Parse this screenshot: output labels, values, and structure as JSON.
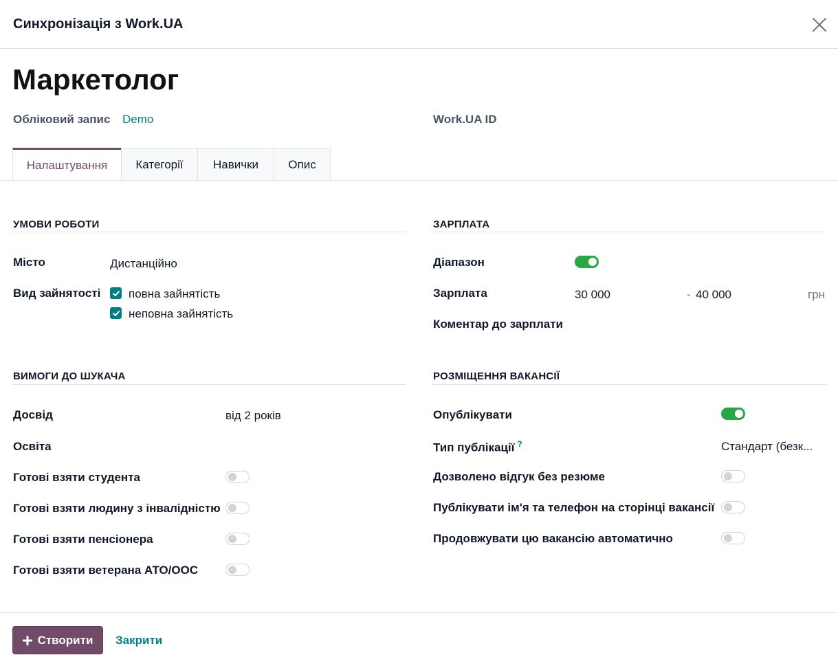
{
  "dialog": {
    "title": "Синхронізація з Work.UA"
  },
  "record": {
    "name": "Маркетолог",
    "account_label": "Обліковий запис",
    "account_value": "Demo",
    "workua_id_label": "Work.UA ID"
  },
  "tabs": [
    {
      "label": "Налаштування",
      "active": true
    },
    {
      "label": "Категорії",
      "active": false
    },
    {
      "label": "Навички",
      "active": false
    },
    {
      "label": "Опис",
      "active": false
    }
  ],
  "conditions": {
    "title": "УМОВИ РОБОТИ",
    "city_label": "Місто",
    "city_value": "Дистанційно",
    "employment_label": "Вид зайнятості",
    "employment_options": [
      {
        "label": "повна зайнятість",
        "checked": true
      },
      {
        "label": "неповна зайнятість",
        "checked": true
      }
    ]
  },
  "salary": {
    "title": "ЗАРПЛАТА",
    "range_label": "Діапазон",
    "range_enabled": true,
    "salary_label": "Зарплата",
    "from": "30 000",
    "separator": "-",
    "to": "40 000",
    "currency": "грн",
    "comment_label": "Коментар до зарплати"
  },
  "requirements": {
    "title": "ВИМОГИ ДО ШУКАЧА",
    "experience_label": "Досвід",
    "experience_value": "від 2 років",
    "education_label": "Освіта",
    "student_label": "Готові взяти студента",
    "student": false,
    "disability_label": "Готові взяти людину з інвалідністю",
    "disability": false,
    "pensioner_label": "Готові взяти пенсіонера",
    "pensioner": false,
    "veteran_label": "Готові взяти ветерана АТО/ООС",
    "veteran": false
  },
  "placement": {
    "title": "РОЗМІЩЕННЯ ВАКАНСІЇ",
    "publish_label": "Опублікувати",
    "publish": true,
    "pub_type_label": "Тип публікації",
    "pub_type_help": "?",
    "pub_type_value": "Стандарт (безк...",
    "no_resume_label": "Дозволено відгук без резюме",
    "no_resume": false,
    "show_contacts_label": "Публікувати ім'я та телефон на сторінці вакансії",
    "show_contacts": false,
    "auto_extend_label": "Продовжувати цю вакансію автоматично",
    "auto_extend": false
  },
  "footer": {
    "create_label": "Створити",
    "close_label": "Закрити"
  },
  "colors": {
    "brand": "#714b67",
    "accent": "#017e84",
    "toggle_on": "#28a745"
  }
}
